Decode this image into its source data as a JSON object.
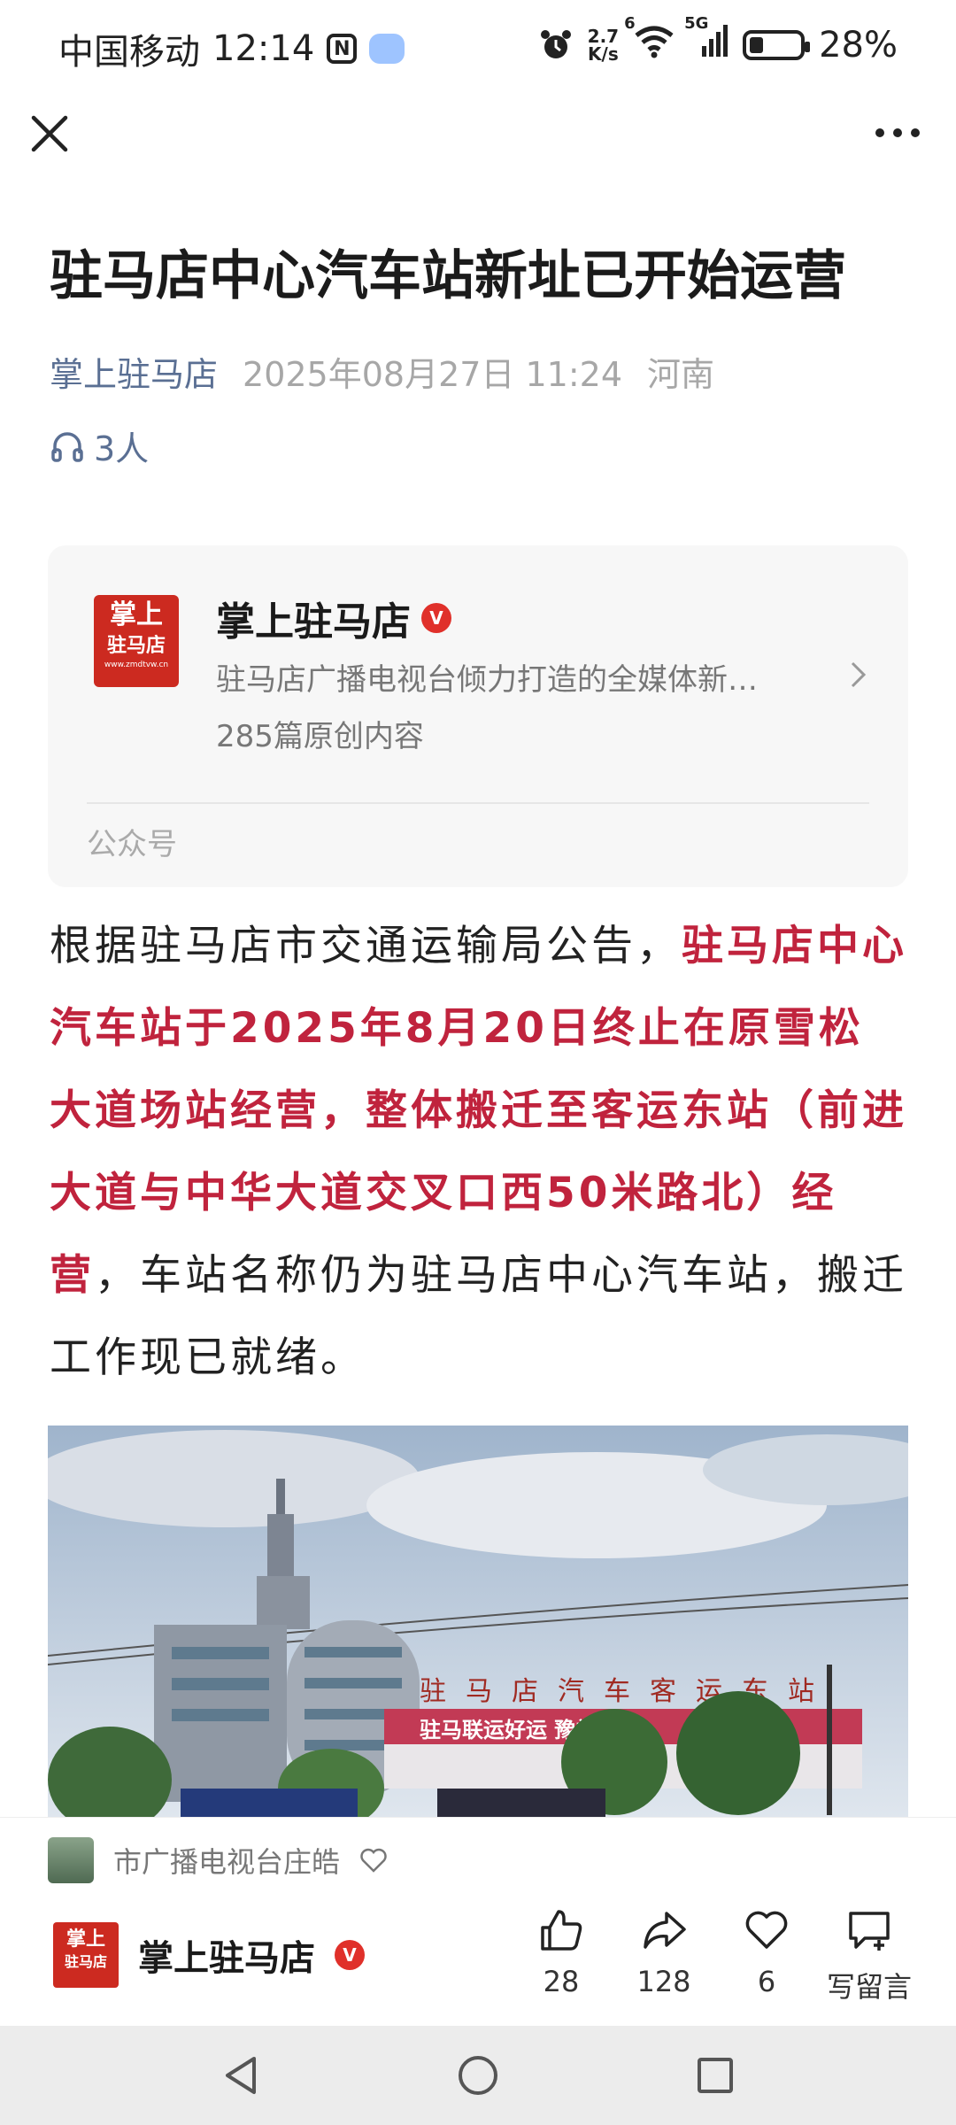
{
  "status_bar": {
    "carrier": "中国移动",
    "time": "12:14",
    "nfc": "N",
    "speed_top": "2.7",
    "speed_bottom": "K/s",
    "wifi_badge": "6",
    "network": "5G",
    "battery": "28%",
    "battery_level": 0.28
  },
  "article": {
    "title": "驻马店中心汽车站新址已开始运营",
    "source": "掌上驻马店",
    "datetime": "2025年08月27日 11:24",
    "region": "河南",
    "listeners": "3人"
  },
  "account_card": {
    "logo_text_top": "掌上",
    "logo_text_bottom": "驻马店",
    "logo_url_text": "www.zmdtvw.cn",
    "name": "掌上驻马店",
    "verified_mark": "V",
    "description": "驻马店广播电视台倾力打造的全媒体新…",
    "articles_count": "285篇原创内容",
    "footer": "公众号"
  },
  "body": {
    "intro": "根据驻马店市交通运输局公告，",
    "highlight": "驻马店中心汽车站于2025年8月20日终止在原雪松大道场站经营，整体搬迁至客运东站（前进大道与中华大道交叉口西50米路北）经营",
    "rest": "，车站名称仍为驻马店中心汽车站，搬迁工作现已就绪。"
  },
  "photo": {
    "sign_text": "驻马店汽车客运东站",
    "banner_text": "驻马联运好运  豫礼到家"
  },
  "bottom": {
    "author": "市广播电视台庄皓",
    "account_name": "掌上驻马店",
    "verified_mark": "V",
    "logo_text_top": "掌上",
    "logo_text_bottom": "驻马店",
    "like_count": "28",
    "share_count": "128",
    "favorite_count": "6",
    "comment_label": "写留言"
  }
}
